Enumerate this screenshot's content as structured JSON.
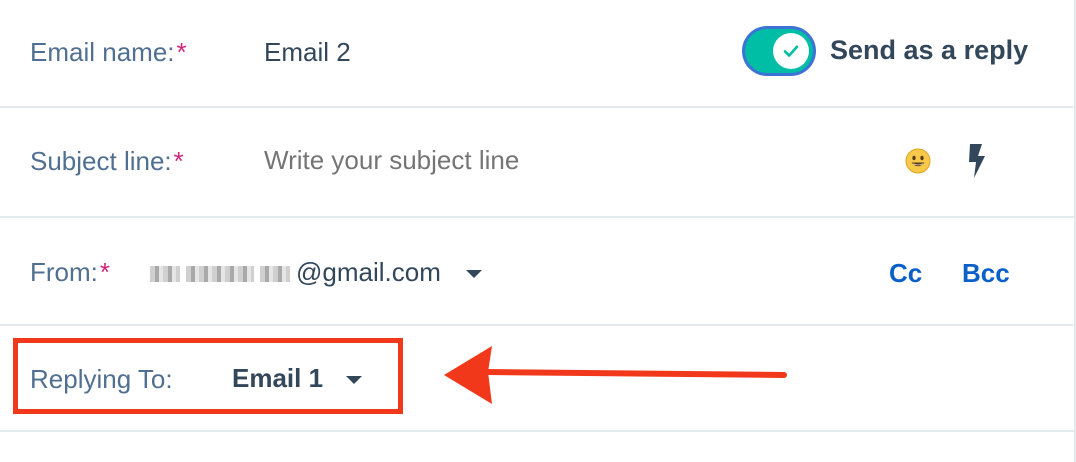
{
  "email_name": {
    "label": "Email name:",
    "required_mark": "*",
    "value": "Email 2"
  },
  "send_as_reply": {
    "label": "Send as a reply",
    "checked": true,
    "track_color": "#00bda5",
    "focus_ring_color": "#3d73d4"
  },
  "subject_line": {
    "label": "Subject line:",
    "required_mark": "*",
    "placeholder": "Write your subject line",
    "emoji_icon": "emoji-picker-icon",
    "personalize_icon": "lightning-bolt-icon"
  },
  "from": {
    "label": "From:",
    "required_mark": "*",
    "email_visible": "@gmail.com",
    "dropdown_icon": "caret-down-icon",
    "cc_label": "Cc",
    "bcc_label": "Bcc"
  },
  "replying_to": {
    "label": "Replying To:",
    "value": "Email 1",
    "dropdown_icon": "caret-down-icon"
  },
  "annotation": {
    "highlight_color": "#f2381b",
    "arrow_icon": "arrow-left-icon"
  },
  "colors": {
    "label_text": "#516f90",
    "value_text": "#33475b",
    "required": "#d0257a",
    "link": "#0b60c8",
    "divider": "#e6eaee"
  }
}
